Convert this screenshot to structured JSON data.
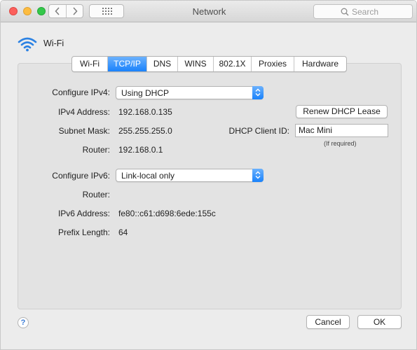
{
  "window": {
    "title": "Network",
    "search_placeholder": "Search"
  },
  "interface": {
    "name": "Wi-Fi"
  },
  "tabs": [
    {
      "label": "Wi-Fi"
    },
    {
      "label": "TCP/IP"
    },
    {
      "label": "DNS"
    },
    {
      "label": "WINS"
    },
    {
      "label": "802.1X"
    },
    {
      "label": "Proxies"
    },
    {
      "label": "Hardware"
    }
  ],
  "active_tab": "TCP/IP",
  "ipv4": {
    "configure_label": "Configure IPv4:",
    "configure_value": "Using DHCP",
    "address_label": "IPv4 Address:",
    "address_value": "192.168.0.135",
    "subnet_label": "Subnet Mask:",
    "subnet_value": "255.255.255.0",
    "router_label": "Router:",
    "router_value": "192.168.0.1"
  },
  "dhcp": {
    "renew_label": "Renew DHCP Lease",
    "client_id_label": "DHCP Client ID:",
    "client_id_value": "Mac Mini",
    "client_id_hint": "(If required)"
  },
  "ipv6": {
    "configure_label": "Configure IPv6:",
    "configure_value": "Link-local only",
    "router_label": "Router:",
    "address_label": "IPv6 Address:",
    "address_value": "fe80::c61:d698:6ede:155c",
    "prefix_label": "Prefix Length:",
    "prefix_value": "64"
  },
  "footer": {
    "help_label": "?",
    "cancel_label": "Cancel",
    "ok_label": "OK"
  },
  "colors": {
    "accent": "#1a82fb",
    "window_bg": "#ececec",
    "panel_bg": "#e3e3e3"
  }
}
